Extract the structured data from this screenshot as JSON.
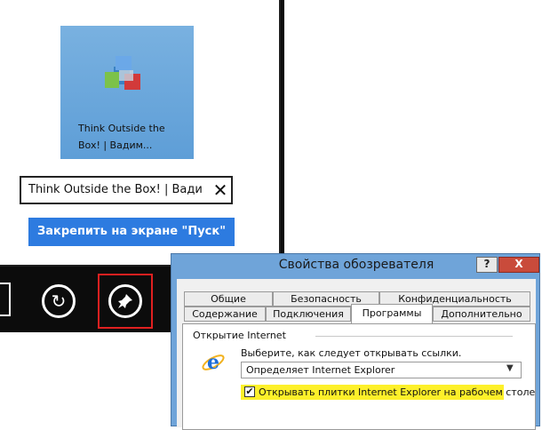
{
  "flyout": {
    "tile_text": "Think Outside the Box! | Вадим...",
    "name_value": "Think Outside the Box! | Вади",
    "clear_glyph": "✕",
    "pin_label": "Закрепить на экране \"Пуск\""
  },
  "appbar": {
    "refresh_glyph": "↻",
    "pin_glyph": "📌"
  },
  "dialog": {
    "title": "Свойства обозревателя",
    "help_label": "?",
    "close_label": "X",
    "tabs_row1": [
      "Общие",
      "Безопасность",
      "Конфиденциальность"
    ],
    "tabs_row2": [
      "Содержание",
      "Подключения",
      "Программы",
      "Дополнительно"
    ],
    "group_label": "Открытие Internet",
    "prompt": "Выберите, как следует открывать ссылки.",
    "browser_select_value": "Определяет Internet Explorer",
    "tiles_checkbox_checked": "✔",
    "tiles_checkbox_label": "Открывать плитки Internet Explorer на рабочем столе",
    "highlight_color": "#fdf02a"
  }
}
